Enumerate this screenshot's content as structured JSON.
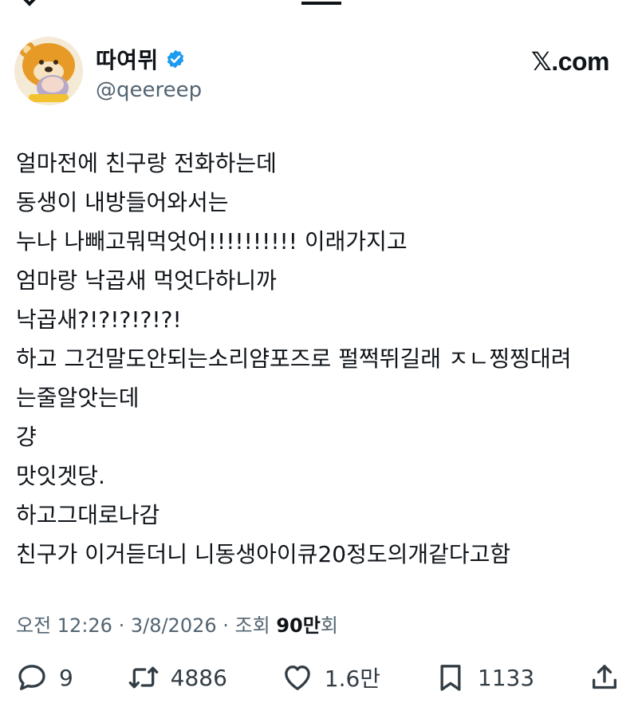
{
  "author": {
    "display_name": "따여뮈",
    "handle": "@qeereep",
    "verified": true
  },
  "brand": "𝕏.com",
  "tweet_lines": [
    "얼마전에 친구랑 전화하는데",
    "동생이 내방들어와서는",
    "누나 나빼고뭐먹엇어!!!!!!!!!! 이래가지고",
    "엄마랑 낙곱새 먹엇다하니까",
    "낙곱새?!?!?!?!?!",
    "하고 그건말도안되는소리얌포즈로 펄쩍뛰길래 ㅈㄴ찡찡대려",
    "는줄알앗는데",
    "걍",
    "맛잇겟당.",
    "하고그대로나감",
    "친구가 이거듣더니 니동생아이큐20정도의개같다고함"
  ],
  "meta": {
    "time": "오전 12:26",
    "date": "3/8/2026",
    "views_label": "조회",
    "views_value": "90만",
    "views_suffix": "회",
    "separator": " · "
  },
  "actions": {
    "replies": "9",
    "retweets": "4886",
    "likes": "1.6만",
    "bookmarks": "1133"
  },
  "colors": {
    "text": "#0f1419",
    "secondary": "#536471",
    "verified": "#1d9bf0"
  }
}
